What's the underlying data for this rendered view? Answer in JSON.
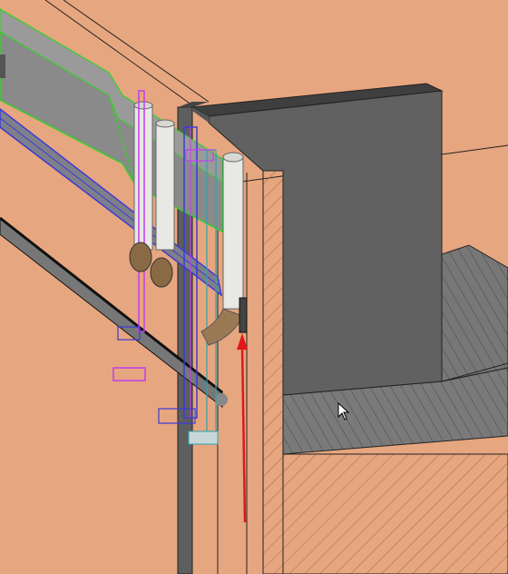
{
  "view": {
    "type": "3d-cad-viewport",
    "colors": {
      "background": "#e6a67f",
      "wall_outline": "#222222",
      "block_front": "#616161",
      "block_top": "#3f3f3f",
      "slab_gray": "#7a7a7a",
      "beam_fill": "#8a8a8a",
      "beam_highlight": "#34d12a",
      "pipe_blue": "#3b3bd6",
      "pipe_magenta": "#c23cf2",
      "pipe_white": "#e8e8e4",
      "fitting_brown": "#8a6a45",
      "arrow_red": "#e01818",
      "hatch": "#a5684a"
    }
  }
}
